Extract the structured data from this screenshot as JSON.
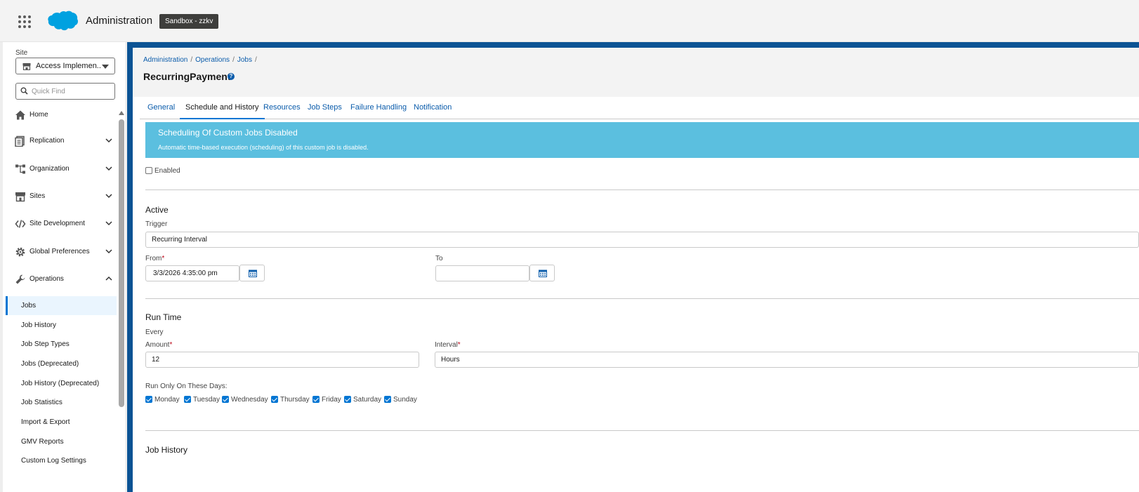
{
  "header": {
    "app_title": "Administration",
    "sandbox_badge": "Sandbox - zzkv"
  },
  "sidebar": {
    "site_label": "Site",
    "site_value": "Access Implemen...",
    "quick_find_placeholder": "Quick Find",
    "nav": [
      {
        "label": "Home",
        "icon": "home-icon",
        "expandable": false
      },
      {
        "label": "Replication",
        "icon": "replication-icon",
        "expandable": true,
        "expanded": false
      },
      {
        "label": "Organization",
        "icon": "organization-icon",
        "expandable": true,
        "expanded": false
      },
      {
        "label": "Sites",
        "icon": "store-icon",
        "expandable": true,
        "expanded": false
      },
      {
        "label": "Site Development",
        "icon": "code-icon",
        "expandable": true,
        "expanded": false
      },
      {
        "label": "Global Preferences",
        "icon": "gear-icon",
        "expandable": true,
        "expanded": false
      },
      {
        "label": "Operations",
        "icon": "wrench-icon",
        "expandable": true,
        "expanded": true
      }
    ],
    "sub_items": [
      {
        "label": "Jobs",
        "active": true
      },
      {
        "label": "Job History"
      },
      {
        "label": "Job Step Types"
      },
      {
        "label": "Jobs (Deprecated)"
      },
      {
        "label": "Job History (Deprecated)"
      },
      {
        "label": "Job Statistics"
      },
      {
        "label": "Import & Export"
      },
      {
        "label": "GMV Reports"
      },
      {
        "label": "Custom Log Settings"
      }
    ]
  },
  "breadcrumb": [
    "Administration",
    "Operations",
    "Jobs"
  ],
  "record_title": "RecurringPayment",
  "help_icon": "?",
  "tabs": [
    {
      "label": "General"
    },
    {
      "label": "Schedule and History",
      "active": true
    },
    {
      "label": "Resources"
    },
    {
      "label": "Job Steps"
    },
    {
      "label": "Failure Handling"
    },
    {
      "label": "Notification"
    }
  ],
  "banner": {
    "title": "Scheduling Of Custom Jobs Disabled",
    "message": "Automatic time-based execution (scheduling) of this custom job is disabled.",
    "color": "#5bbfdf"
  },
  "enabled": {
    "label": "Enabled",
    "checked": false
  },
  "active_section": {
    "title": "Active",
    "trigger_label": "Trigger",
    "trigger_value": "Recurring Interval",
    "from_label": "From",
    "from_value": "3/3/2026 4:35:00 pm",
    "to_label": "To",
    "to_value": ""
  },
  "run_time": {
    "title": "Run Time",
    "every_label": "Every",
    "amount_label": "Amount",
    "amount_value": "12",
    "interval_label": "Interval",
    "interval_value": "Hours",
    "days_label": "Run Only On These Days:",
    "days": [
      {
        "label": "Monday",
        "checked": true
      },
      {
        "label": "Tuesday",
        "checked": true
      },
      {
        "label": "Wednesday",
        "checked": true
      },
      {
        "label": "Thursday",
        "checked": true
      },
      {
        "label": "Friday",
        "checked": true
      },
      {
        "label": "Saturday",
        "checked": true
      },
      {
        "label": "Sunday",
        "checked": true
      }
    ]
  },
  "job_history": {
    "title": "Job History"
  },
  "colors": {
    "brand": "#0b5394",
    "link": "#0b5cab",
    "accent": "#0176d3"
  }
}
